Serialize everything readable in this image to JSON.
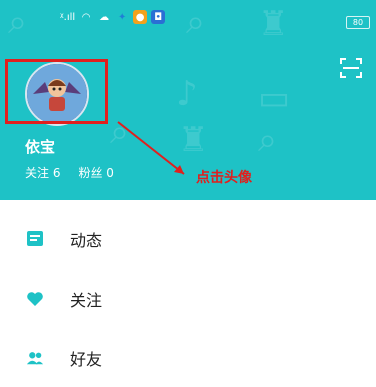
{
  "colors": {
    "accent": "#1ec2c6",
    "annotation": "#e0201e"
  },
  "statusbar": {
    "signal": "ᵡ.ıll",
    "battery": "80"
  },
  "header": {
    "username": "依宝",
    "following_label": "关注 6",
    "fans_label": "粉丝 0",
    "scan_icon": "scan-icon"
  },
  "annotation": {
    "text": "点击头像"
  },
  "menu": {
    "items": [
      {
        "label": "动态",
        "icon": "feed-icon"
      },
      {
        "label": "关注",
        "icon": "heart-icon"
      },
      {
        "label": "好友",
        "icon": "friends-icon"
      }
    ]
  }
}
